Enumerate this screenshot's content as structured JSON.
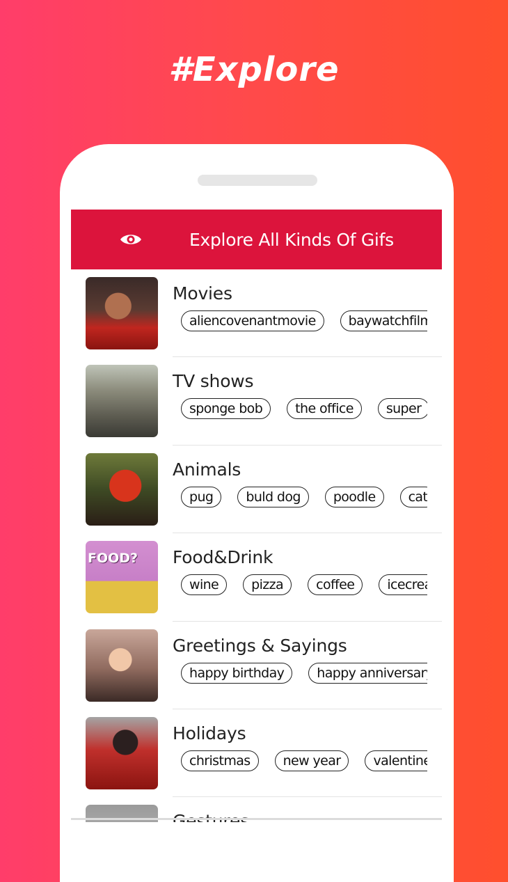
{
  "promo": {
    "title": "#Explore"
  },
  "appbar": {
    "icon": "eye-icon",
    "title": "Explore All Kinds Of Gifs"
  },
  "categories": [
    {
      "title": "Movies",
      "thumb_icon": "movie-thumbnail",
      "tags": [
        "aliencovenantmovie",
        "baywatchfilm"
      ]
    },
    {
      "title": "TV shows",
      "thumb_icon": "tv-thumbnail",
      "tags": [
        "sponge bob",
        "the office",
        "super"
      ]
    },
    {
      "title": "Animals",
      "thumb_icon": "animal-thumbnail",
      "tags": [
        "pug",
        "buld dog",
        "poodle",
        "cat"
      ]
    },
    {
      "title": "Food&Drink",
      "thumb_icon": "food-thumbnail",
      "thumb_text": "FOOD?",
      "tags": [
        "wine",
        "pizza",
        "coffee",
        "icecream"
      ]
    },
    {
      "title": "Greetings & Sayings",
      "thumb_icon": "greeting-thumbnail",
      "tags": [
        "happy birthday",
        "happy anniversary"
      ]
    },
    {
      "title": "Holidays",
      "thumb_icon": "holiday-thumbnail",
      "tags": [
        "christmas",
        "new year",
        "valentine"
      ]
    },
    {
      "title": "Gestures",
      "thumb_icon": "gesture-thumbnail",
      "tags": []
    }
  ],
  "colors": {
    "accent": "#dc143c",
    "background_left": "#ff3d6a",
    "background_right": "#ff4f2d"
  }
}
